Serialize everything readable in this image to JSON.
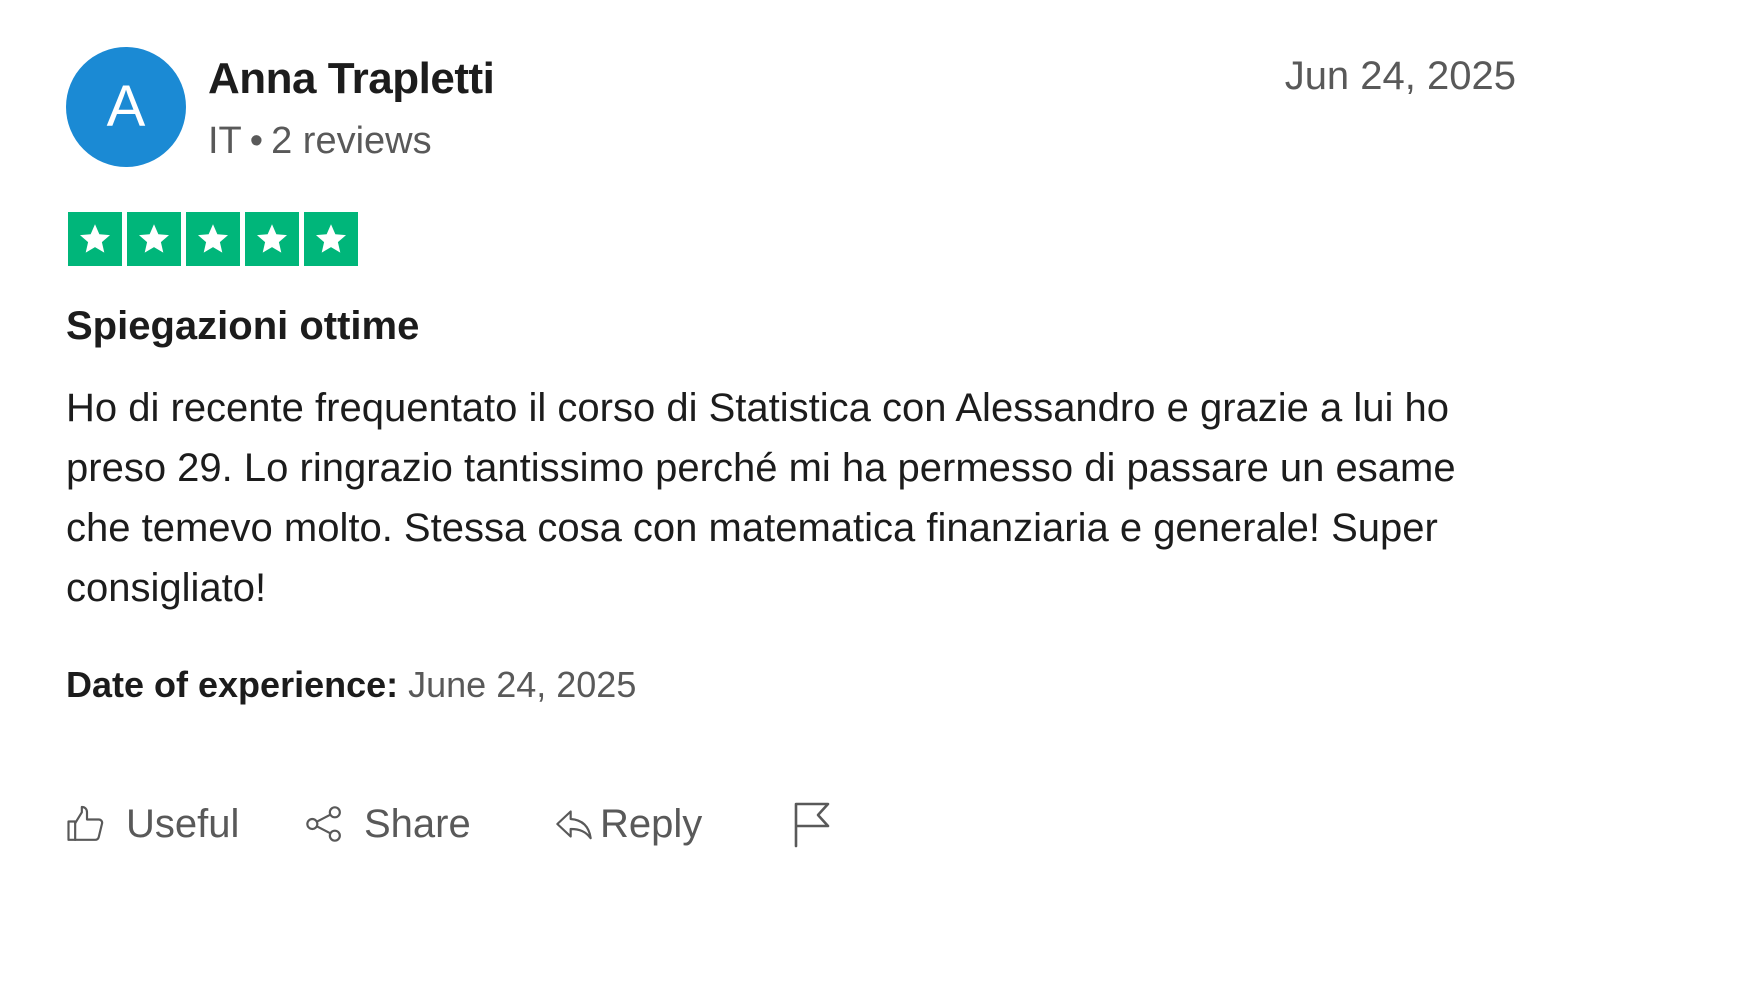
{
  "reviewer": {
    "avatar_initial": "A",
    "avatar_color": "#1b8ad4",
    "name": "Anna Trapletti",
    "country": "IT",
    "separator": "•",
    "reviews_count": "2 reviews"
  },
  "review": {
    "date": "Jun 24, 2025",
    "rating": 5,
    "rating_max": 5,
    "star_color": "#00b67a",
    "title": "Spiegazioni ottime",
    "body": "Ho di recente frequentato il corso di Statistica con Alessandro e grazie a lui ho preso 29. Lo ringrazio tantissimo perché mi ha permesso di passare un esame che temevo molto. Stessa cosa con matematica finanziaria e generale! Super consigliato!",
    "experience_label": "Date of experience:",
    "experience_date": "June 24, 2025"
  },
  "actions": {
    "useful_label": "Useful",
    "share_label": "Share",
    "reply_label": "Reply",
    "icons": [
      "thumbs-up-icon",
      "share-icon",
      "reply-icon",
      "flag-icon"
    ]
  }
}
